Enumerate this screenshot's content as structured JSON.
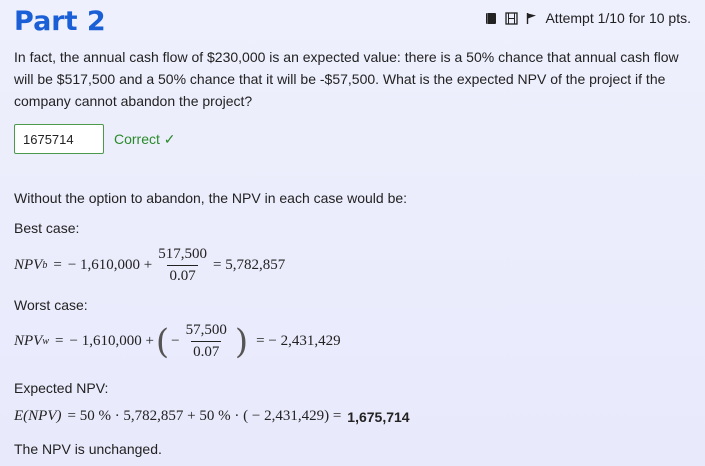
{
  "header": {
    "title": "Part 2",
    "attempt": "Attempt 1/10 for 10 pts.",
    "icons": [
      "notebook-icon",
      "film-icon",
      "flag-icon"
    ]
  },
  "question": {
    "text": "In fact, the annual cash flow of $230,000 is an expected value: there is a 50% chance that annual cash flow will be $517,500 and a 50% chance that it will be -$57,500. What is the expected NPV of the project if the company cannot abandon the project?"
  },
  "answer": {
    "value": "1675714",
    "status": "Correct ✓"
  },
  "solution": {
    "intro": "Without the option to abandon, the NPV in each case would be:",
    "best_label": "Best case:",
    "best": {
      "lhs": "NPV",
      "lhs_sub": "b",
      "eq": "=",
      "term1": "− 1,610,000 +",
      "num": "517,500",
      "den": "0.07",
      "result": "= 5,782,857"
    },
    "worst_label": "Worst case:",
    "worst": {
      "lhs": "NPV",
      "lhs_sub": "w",
      "eq": "=",
      "term1": "− 1,610,000 +",
      "minus": "−",
      "num": "57,500",
      "den": "0.07",
      "result": "= − 2,431,429"
    },
    "expected_label": "Expected NPV:",
    "expected": {
      "lhs": "E(NPV)",
      "rhs": "= 50 % · 5,782,857 + 50 % · ( − 2,431,429) =",
      "result": "1,675,714"
    },
    "conclusion": "The NPV is unchanged."
  }
}
